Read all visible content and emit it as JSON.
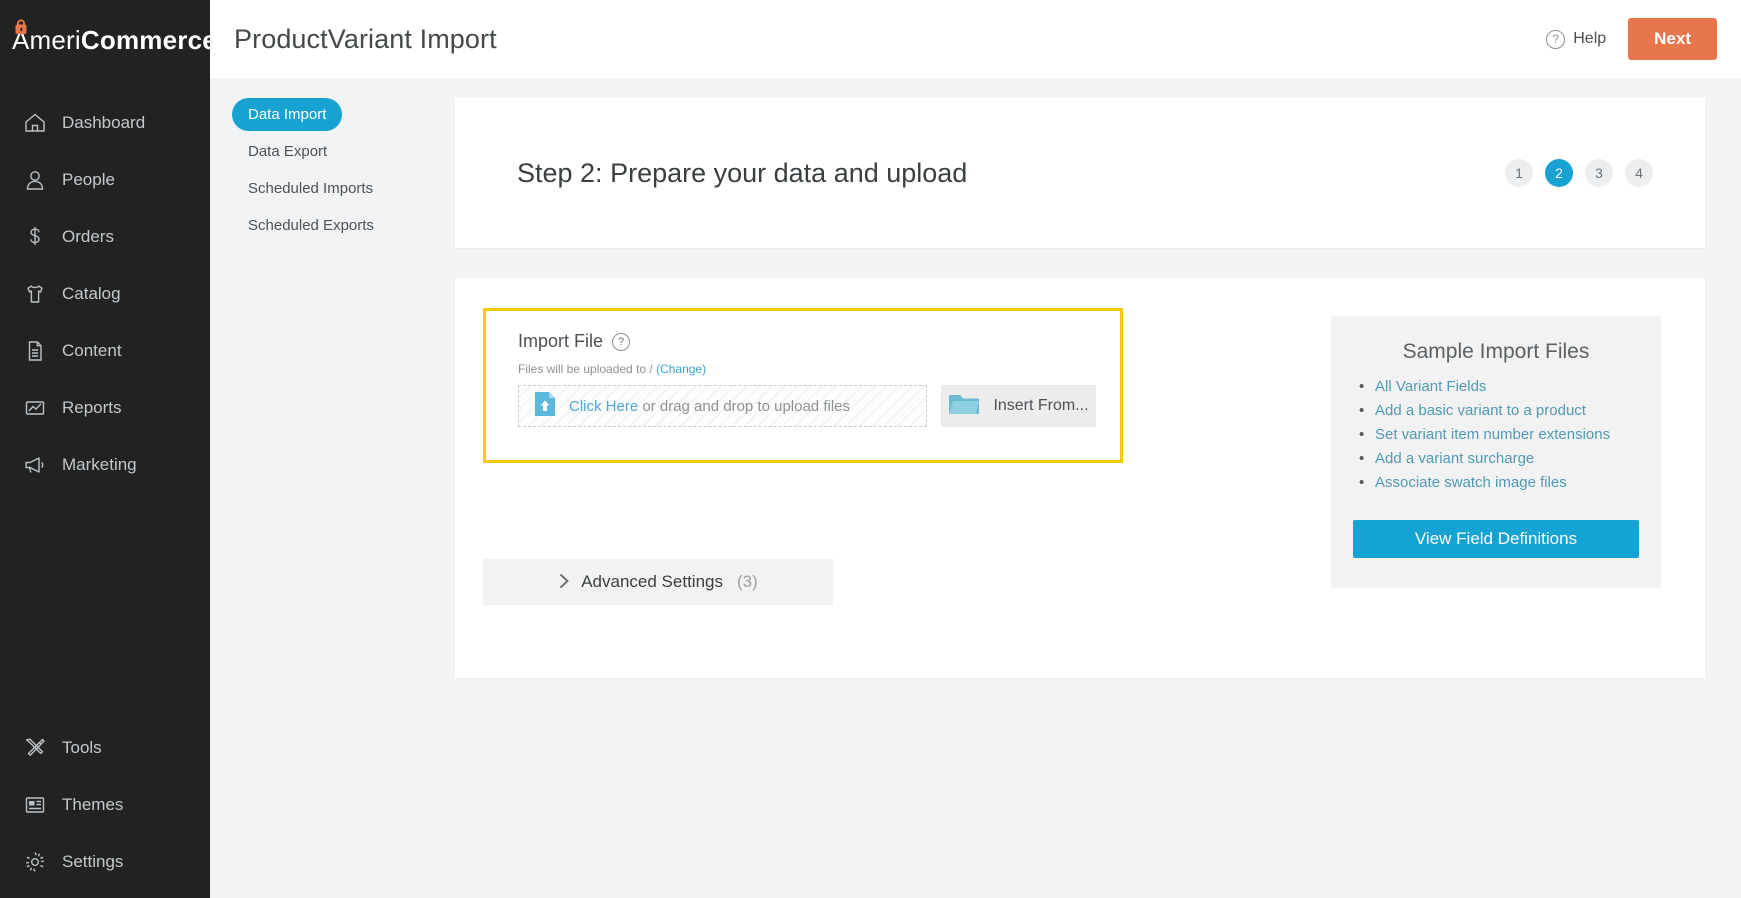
{
  "brand": {
    "name_part1": "Ameri",
    "name_part2": "Commerce",
    "logo_icon": "lock-bag-icon"
  },
  "sidebar": {
    "items": [
      {
        "label": "Dashboard",
        "icon": "home-icon"
      },
      {
        "label": "People",
        "icon": "person-icon"
      },
      {
        "label": "Orders",
        "icon": "dollar-icon"
      },
      {
        "label": "Catalog",
        "icon": "tshirt-icon"
      },
      {
        "label": "Content",
        "icon": "document-icon"
      },
      {
        "label": "Reports",
        "icon": "chart-icon"
      },
      {
        "label": "Marketing",
        "icon": "megaphone-icon"
      }
    ],
    "bottom_items": [
      {
        "label": "Tools",
        "icon": "hammer-wrench-icon"
      },
      {
        "label": "Themes",
        "icon": "layout-icon"
      },
      {
        "label": "Settings",
        "icon": "gear-icon"
      }
    ]
  },
  "header": {
    "title": "ProductVariant Import",
    "help_label": "Help",
    "help_icon": "question-circle-icon",
    "next_label": "Next",
    "next_color": "#e8764d"
  },
  "subnav": {
    "items": [
      {
        "label": "Data Import",
        "active": true
      },
      {
        "label": "Data Export",
        "active": false
      },
      {
        "label": "Scheduled Imports",
        "active": false
      },
      {
        "label": "Scheduled Exports",
        "active": false
      }
    ],
    "active_color": "#17a2d2"
  },
  "step_header": {
    "title": "Step 2: Prepare your data and upload",
    "steps": [
      "1",
      "2",
      "3",
      "4"
    ],
    "active_step": "2",
    "active_color": "#17a2d2"
  },
  "import_file": {
    "title": "Import File",
    "help_icon": "question-circle-icon",
    "upload_note_prefix": "Files will be uploaded to / ",
    "change_link": "(Change)",
    "dropzone_link": "Click Here",
    "dropzone_text": " or drag and drop to upload files",
    "dropzone_icon": "file-upload-icon",
    "insert_from_label": "Insert From...",
    "insert_from_icon": "folder-icon",
    "highlight_color": "#f8c90d"
  },
  "sample_panel": {
    "title": "Sample Import Files",
    "links": [
      "All Variant Fields",
      "Add a basic variant to a product",
      "Set variant item number extensions",
      "Add a variant surcharge",
      "Associate swatch image files"
    ],
    "button_label": "View Field Definitions",
    "button_color": "#14a3d2"
  },
  "advanced_settings": {
    "chevron_icon": "chevron-right-icon",
    "label": "Advanced Settings",
    "count": "(3)"
  }
}
